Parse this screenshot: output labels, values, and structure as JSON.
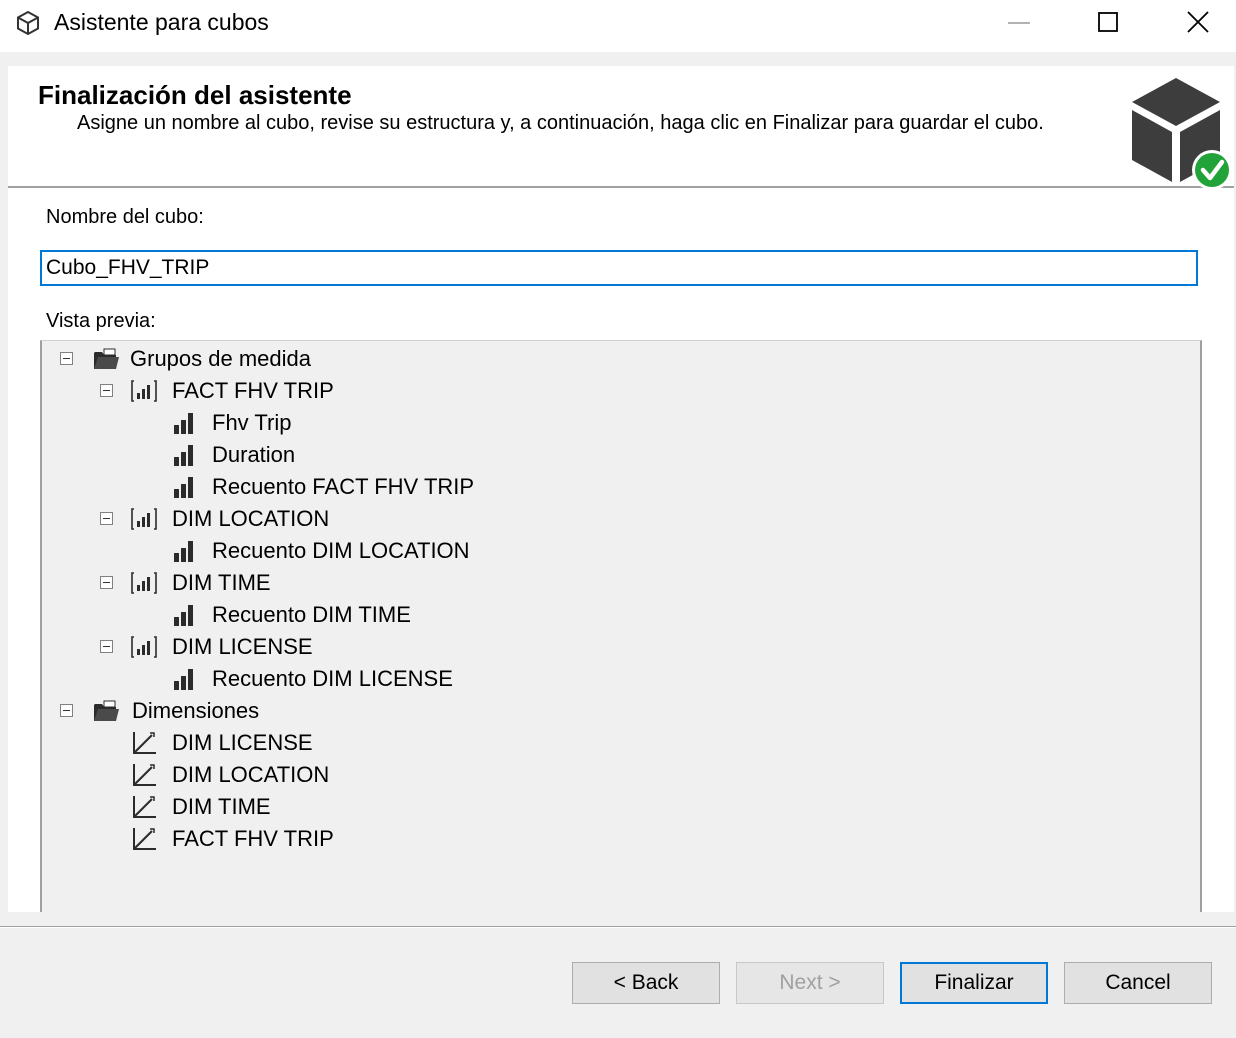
{
  "window": {
    "title": "Asistente para cubos",
    "app_icon": "cube-icon",
    "controls": [
      "minimize-icon",
      "maximize-icon",
      "close-icon"
    ]
  },
  "header": {
    "title": "Finalización del asistente",
    "description": "Asigne un nombre al cubo, revise su estructura y, a continuación, haga clic en Finalizar para guardar el cubo.",
    "logo_icon": "cube-check-icon"
  },
  "form": {
    "name_label": "Nombre del cubo:",
    "name_value": "Cubo_FHV_TRIP",
    "preview_label": "Vista previa:"
  },
  "tree": {
    "measure_groups": {
      "label": "Grupos de medida",
      "icon": "folder-icon",
      "groups": [
        {
          "label": "FACT FHV TRIP",
          "icon": "measure-group-icon",
          "measures": [
            "Fhv Trip",
            "Duration",
            "Recuento FACT FHV TRIP"
          ]
        },
        {
          "label": "DIM LOCATION",
          "icon": "measure-group-icon",
          "measures": [
            "Recuento DIM LOCATION"
          ]
        },
        {
          "label": "DIM TIME",
          "icon": "measure-group-icon",
          "measures": [
            "Recuento DIM TIME"
          ]
        },
        {
          "label": "DIM LICENSE",
          "icon": "measure-group-icon",
          "measures": [
            "Recuento DIM LICENSE"
          ]
        }
      ]
    },
    "dimensions": {
      "label": "Dimensiones",
      "icon": "folder-icon",
      "items": [
        "DIM LICENSE",
        "DIM LOCATION",
        "DIM TIME",
        "FACT FHV TRIP"
      ]
    }
  },
  "buttons": {
    "back": "< Back",
    "next": "Next >",
    "finish": "Finalizar",
    "cancel": "Cancel"
  },
  "colors": {
    "focus_blue": "#0078d7",
    "check_green": "#22a33a",
    "disabled_text": "#a0a0a0"
  }
}
